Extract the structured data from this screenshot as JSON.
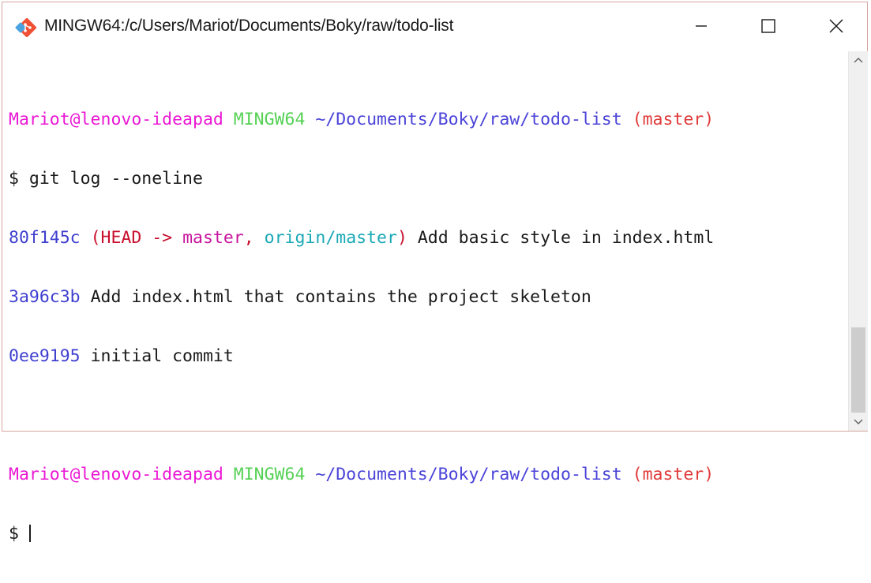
{
  "window": {
    "title": "MINGW64:/c/Users/Mariot/Documents/Boky/raw/todo-list",
    "icon": "git-icon",
    "controls": [
      "minimize-icon",
      "maximize-icon",
      "close-icon"
    ]
  },
  "colors": {
    "user": "#ea18d4",
    "host": "#55d155",
    "path": "#4b44d8",
    "branch": "#e03a3a",
    "hash": "#3f3fd0",
    "head": "#c8102e",
    "master": "#c8169e",
    "origin": "#1aa9b5",
    "git_icon": "#f05033"
  },
  "terminal": {
    "prompt1": {
      "user": "Mariot@lenovo-ideapad",
      "host": "MINGW64",
      "path": "~/Documents/Boky/raw/todo-list",
      "branch": "(master)"
    },
    "command": "$ git log --oneline",
    "log": [
      {
        "hash": "80f145c",
        "paren_open": "(",
        "head": "HEAD ->",
        "master": "master",
        "comma": ",",
        "origin": "origin/master",
        "paren_close": ")",
        "message": "Add basic style in index.html"
      },
      {
        "hash": "3a96c3b",
        "message": "Add index.html that contains the project skeleton"
      },
      {
        "hash": "0ee9195",
        "message": "initial commit"
      }
    ],
    "prompt2": {
      "user": "Mariot@lenovo-ideapad",
      "host": "MINGW64",
      "path": "~/Documents/Boky/raw/todo-list",
      "branch": "(master)"
    },
    "current_input": "$ "
  },
  "scrollbar": {
    "up_icon": "chevron-up-icon",
    "down_icon": "chevron-down-icon"
  }
}
